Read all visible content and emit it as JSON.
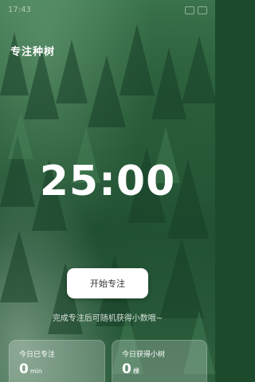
{
  "status_bar": {
    "time": "17:43"
  },
  "header": {
    "title": "专注种树"
  },
  "timer": {
    "display": "25:00"
  },
  "actions": {
    "start_label": "开始专注"
  },
  "hint": {
    "text": "完成专注后可随机获得小数哦~"
  },
  "stats": {
    "today_focus": {
      "label": "今日已专注",
      "value": "0",
      "unit": "min"
    },
    "today_trees": {
      "label": "今日获得小树",
      "value": "0",
      "unit": "棵"
    }
  },
  "colors": {
    "forest_dark": "#1f4f31",
    "forest_light": "#3f7a52",
    "button_bg": "#ffffff",
    "text_primary": "#ffffff"
  }
}
